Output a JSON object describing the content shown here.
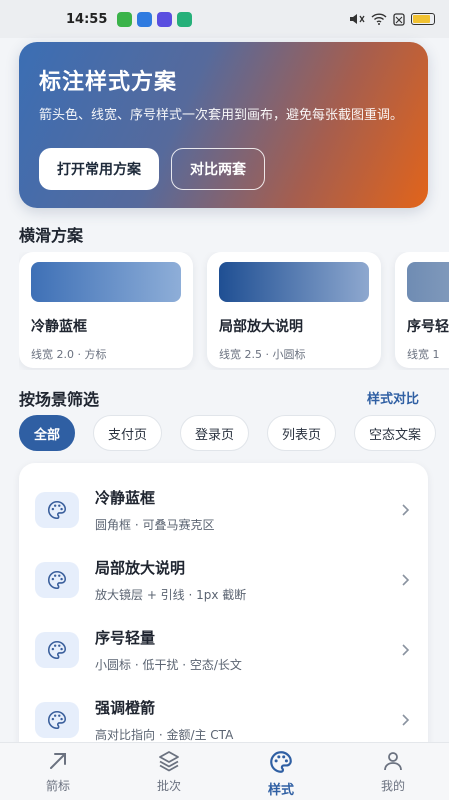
{
  "status_bar": {
    "time": "14:55",
    "app_icons": [
      {
        "name": "app-icon-green",
        "color": "#3bb34a"
      },
      {
        "name": "app-icon-blue",
        "color": "#2f7be0"
      },
      {
        "name": "app-icon-purple",
        "color": "#5a4ee0"
      },
      {
        "name": "app-icon-teal",
        "color": "#26b07a"
      }
    ],
    "battery_level": 0.85
  },
  "hero": {
    "title": "标注样式方案",
    "description": "箭头色、线宽、序号样式一次套用到画布，避免每张截图重调。",
    "primary_button": "打开常用方案",
    "secondary_button": "对比两套"
  },
  "scroll_section": {
    "title": "横滑方案",
    "cards": [
      {
        "title": "冷静蓝框",
        "subtitle": "线宽 2.0 · 方标",
        "swatch_from": "#3e70b6",
        "swatch_to": "#8eaed8"
      },
      {
        "title": "局部放大说明",
        "subtitle": "线宽 2.5 · 小圆标",
        "swatch_from": "#1f4f93",
        "swatch_to": "#8ea8cf"
      },
      {
        "title": "序号轻",
        "subtitle": "线宽 1",
        "swatch_from": "#6f8cb3",
        "swatch_to": "#a8b8cf"
      }
    ]
  },
  "filter_section": {
    "title": "按场景筛选",
    "link": "样式对比",
    "chips": [
      "全部",
      "支付页",
      "登录页",
      "列表页",
      "空态文案"
    ],
    "active_chip": 0
  },
  "styles": [
    {
      "title": "冷静蓝框",
      "subtitle": "圆角框 · 可叠马赛克区"
    },
    {
      "title": "局部放大说明",
      "subtitle": "放大镜层 + 引线 · 1px 截断"
    },
    {
      "title": "序号轻量",
      "subtitle": "小圆标 · 低干扰 · 空态/长文"
    },
    {
      "title": "强调橙箭",
      "subtitle": "高对比指向 · 金额/主 CTA"
    }
  ],
  "bottom_nav": {
    "items": [
      {
        "label": "箭标",
        "icon": "arrow-icon"
      },
      {
        "label": "批次",
        "icon": "layers-icon"
      },
      {
        "label": "样式",
        "icon": "palette-icon"
      },
      {
        "label": "我的",
        "icon": "user-icon"
      }
    ],
    "active": 2
  },
  "colors": {
    "accent": "#2f5fa3",
    "hero_gradient_start": "#3b6eb4",
    "hero_gradient_end": "#e2641a"
  }
}
